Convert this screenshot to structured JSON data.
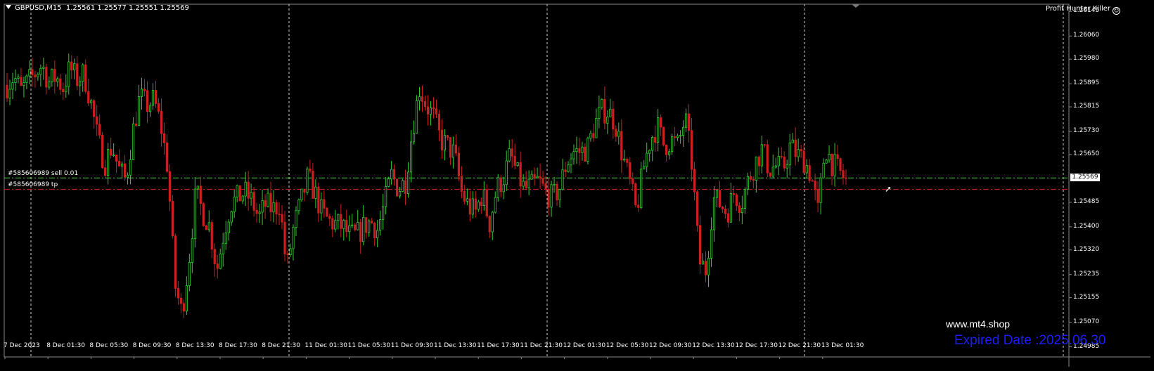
{
  "header": {
    "symbol_line": "GBPUSD,M15  1.25561 1.25577 1.25551 1.25569",
    "expert_name": "Profit Hunter Killer"
  },
  "chart_data": {
    "type": "candlestick",
    "symbol": "GBPUSD",
    "timeframe": "M15",
    "ohlc_header": {
      "open": 1.25561,
      "high": 1.25577,
      "low": 1.25551,
      "close": 1.25569
    },
    "current_price": "1.25569",
    "ylim": [
      1.2495,
      1.2617
    ],
    "y_ticks": [
      "1.26145",
      "1.26060",
      "1.25980",
      "1.25895",
      "1.25815",
      "1.25730",
      "1.25650",
      "1.25569",
      "1.25485",
      "1.25400",
      "1.25320",
      "1.25235",
      "1.25155",
      "1.25070",
      "1.24985"
    ],
    "x_ticks": [
      "7 Dec 2023",
      "8 Dec 01:30",
      "8 Dec 05:30",
      "8 Dec 09:30",
      "8 Dec 13:30",
      "8 Dec 17:30",
      "8 Dec 21:30",
      "11 Dec 01:30",
      "11 Dec 05:30",
      "11 Dec 09:30",
      "11 Dec 13:30",
      "11 Dec 17:30",
      "11 Dec 21:30",
      "12 Dec 01:30",
      "12 Dec 05:30",
      "12 Dec 09:30",
      "12 Dec 13:30",
      "12 Dec 17:30",
      "12 Dec 21:30",
      "13 Dec 01:30"
    ],
    "grid": "vertical dotted separators",
    "bull_color": "#32cd32",
    "bear_color": "#cc1f1f",
    "orders": [
      {
        "label": "#585606989 sell 0.01",
        "price": 1.25569,
        "color": "#44cc44"
      },
      {
        "label": "#585606989 tp",
        "price": 1.2553,
        "color": "#cc2222"
      }
    ],
    "price_path": [
      1.2589,
      1.2592,
      1.2587,
      1.259,
      1.2593,
      1.2596,
      1.259,
      1.2592,
      1.2588,
      1.2595,
      1.2591,
      1.2593,
      1.2583,
      1.257,
      1.2562,
      1.2568,
      1.256,
      1.2556,
      1.2573,
      1.2585,
      1.2582,
      1.2584,
      1.2575,
      1.256,
      1.252,
      1.251,
      1.2528,
      1.2552,
      1.2545,
      1.254,
      1.2525,
      1.2538,
      1.2548,
      1.255,
      1.2552,
      1.2549,
      1.2543,
      1.2548,
      1.2546,
      1.2548,
      1.2525,
      1.254,
      1.2548,
      1.2557,
      1.2552,
      1.2545,
      1.2542,
      1.2541,
      1.254,
      1.2537,
      1.2537,
      1.254,
      1.2542,
      1.2539,
      1.2548,
      1.2558,
      1.2553,
      1.2556,
      1.2574,
      1.2588,
      1.2582,
      1.2578,
      1.257,
      1.2568,
      1.2565,
      1.2552,
      1.2547,
      1.2545,
      1.2552,
      1.2541,
      1.2553,
      1.2557,
      1.2565,
      1.2558,
      1.2553,
      1.2554,
      1.2556,
      1.2552,
      1.255,
      1.2553,
      1.2562,
      1.2566,
      1.2566,
      1.2567,
      1.2575,
      1.258,
      1.258,
      1.2576,
      1.2565,
      1.2556,
      1.2545,
      1.256,
      1.257,
      1.2575,
      1.2568,
      1.257,
      1.2568,
      1.2578,
      1.2561,
      1.2528,
      1.2525,
      1.255,
      1.2548,
      1.2545,
      1.2552,
      1.2548,
      1.2556,
      1.2562,
      1.2567,
      1.256,
      1.2561,
      1.256,
      1.2568,
      1.2565,
      1.2563,
      1.2558,
      1.2545,
      1.2568,
      1.2562,
      1.2559,
      1.2556
    ]
  },
  "watermark": {
    "site": "www.mt4.shop",
    "expired": "Expired Date :2025.06.30",
    "expired_color": "#1c1cff"
  }
}
